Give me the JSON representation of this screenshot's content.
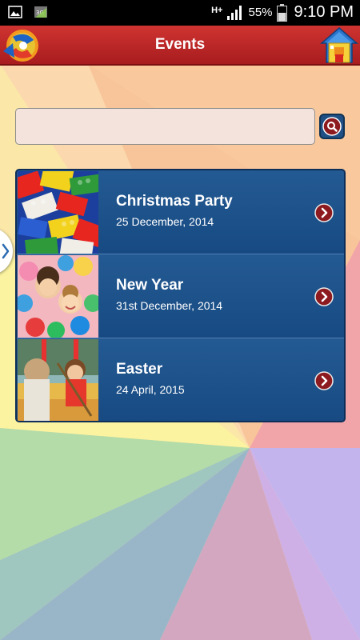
{
  "status_bar": {
    "network": "H+",
    "battery_percent": "55%",
    "time": "9:10 PM",
    "icons": [
      "image-icon",
      "3g-icon",
      "signal-icon",
      "battery-icon"
    ]
  },
  "header": {
    "title": "Events",
    "left_icon": "app-logo-icon",
    "right_icon": "home-icon"
  },
  "search": {
    "placeholder": "",
    "value": "",
    "button_icon": "search-icon"
  },
  "events": [
    {
      "title": "Christmas Party",
      "date": "25 December, 2014",
      "thumbnail": "lego-bricks"
    },
    {
      "title": "New Year",
      "date": "31st December, 2014",
      "thumbnail": "kids-ball-pit"
    },
    {
      "title": "Easter",
      "date": "24 April, 2015",
      "thumbnail": "kids-playground"
    }
  ],
  "colors": {
    "header_red": "#c02a2b",
    "list_blue": "#1b4f86",
    "chevron_red": "#8c1a1f",
    "search_bg": "#f4e2dc"
  }
}
